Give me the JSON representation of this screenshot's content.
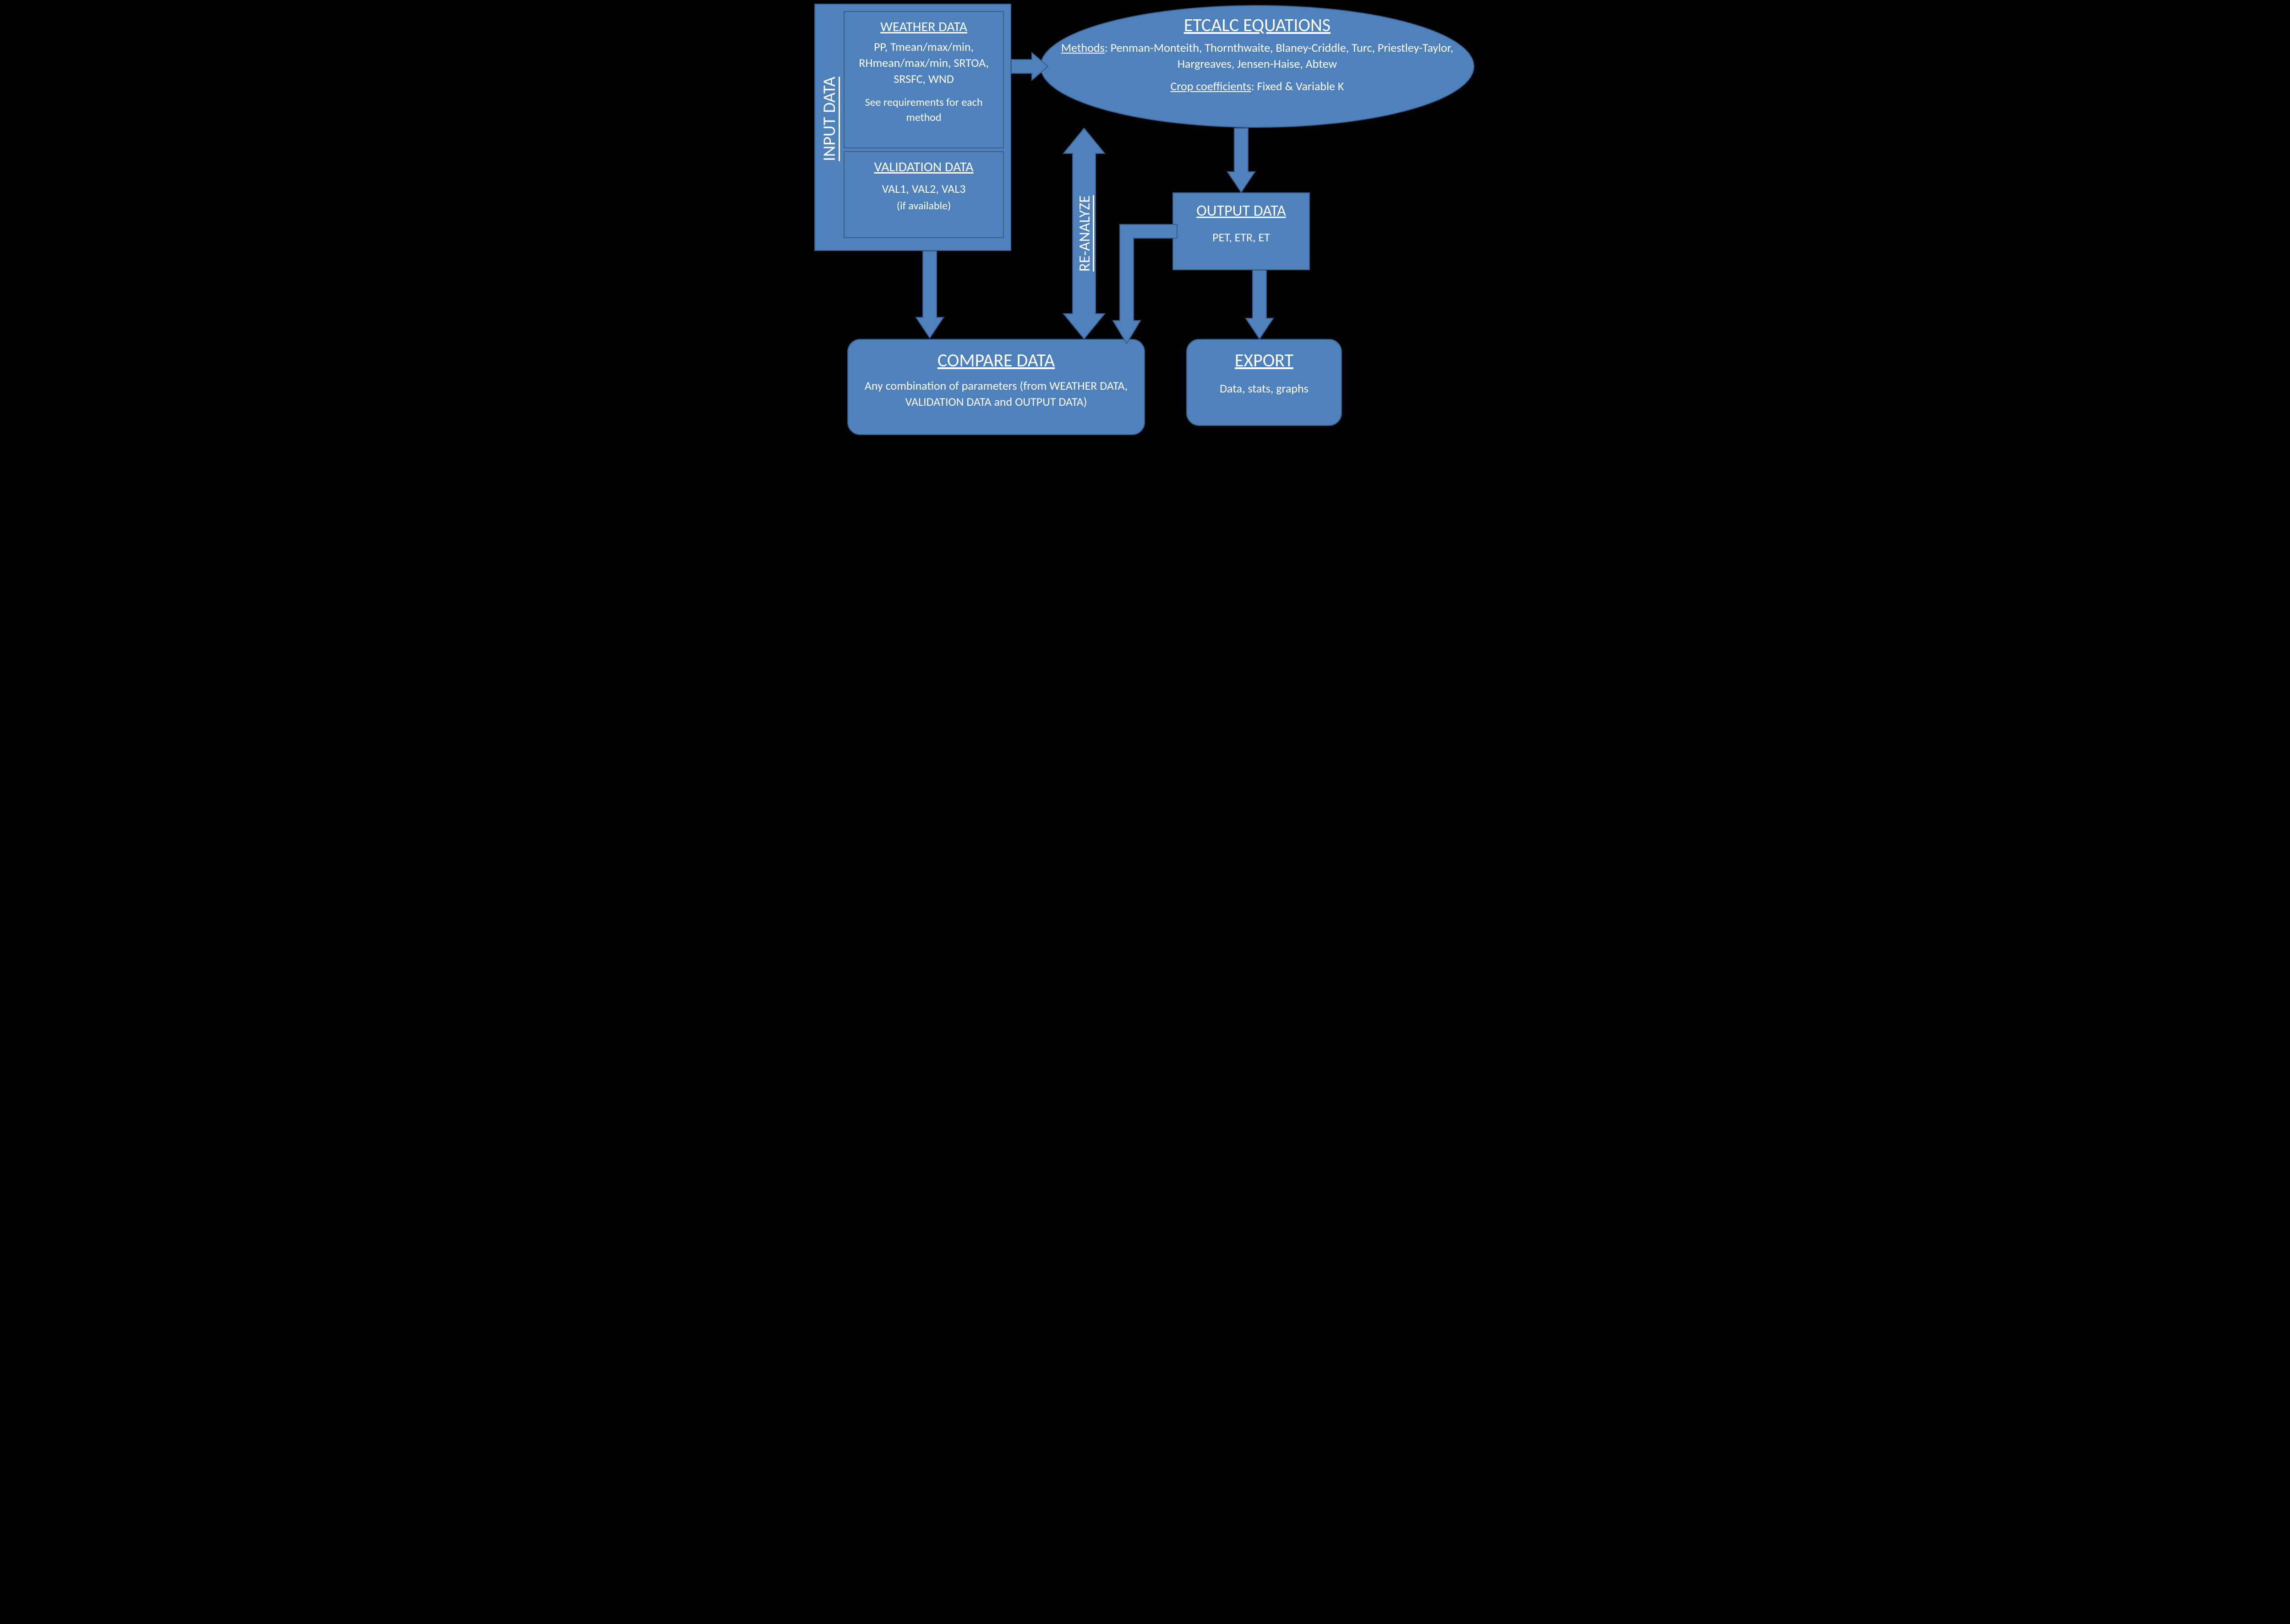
{
  "input": {
    "label": "INPUT DATA",
    "weather": {
      "title": "WEATHER DATA",
      "body": "PP, Tmean/max/min, RHmean/max/min, SRTOA, SRSFC, WND",
      "note": "See requirements for each method"
    },
    "validation": {
      "title": "VALIDATION DATA",
      "body": "VAL1, VAL2, VAL3",
      "note": "(if available)"
    }
  },
  "equations": {
    "title": "ETCALC EQUATIONS",
    "methods_label": "Methods",
    "methods": ": Penman-Monteith, Thornthwaite, Blaney-Criddle, Turc, Priestley-Taylor, Hargreaves, Jensen-Haise, Abtew",
    "coef_label": "Crop coefficients",
    "coef": ": Fixed & Variable K"
  },
  "reanalyze": {
    "label": "RE-ANALYZE"
  },
  "output": {
    "title": "OUTPUT DATA",
    "body": "PET, ETR, ET"
  },
  "compare": {
    "title": "COMPARE DATA",
    "body": "Any combination of parameters (from WEATHER DATA, VALIDATION DATA and OUTPUT DATA)"
  },
  "export": {
    "title": "EXPORT",
    "body": "Data, stats, graphs"
  }
}
